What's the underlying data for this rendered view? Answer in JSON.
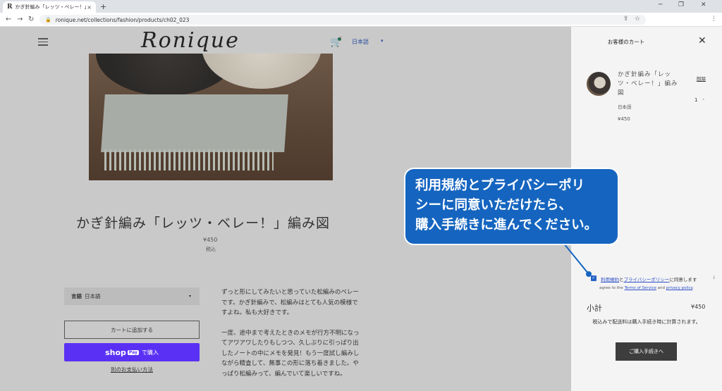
{
  "browser": {
    "tab_favicon": "R",
    "tab_title": "かぎ針編み「レッツ・ベレー！」編み図",
    "tab_close": "×",
    "new_tab": "+",
    "win_min": "─",
    "win_max": "❐",
    "win_close": "✕",
    "back": "←",
    "forward": "→",
    "reload": "↻",
    "lock": "🔒",
    "url": "ronique.net/collections/fashion/products/ch02_023",
    "share": "⇪",
    "star": "☆",
    "menu": "⋮"
  },
  "header": {
    "logo": "Ronique",
    "cart_icon": "🛒",
    "language": "日本語",
    "lang_caret": "▾"
  },
  "product": {
    "title": "かぎ針編み「レッツ・ベレー！」編み図",
    "price": "¥450",
    "tax_note": "税込",
    "option_label": "言語",
    "option_value": "日本語",
    "option_caret": "▾",
    "add_to_cart": "カートに追加する",
    "shop_pay_brand": "shop",
    "shop_pay_badge": "Pay",
    "shop_pay_suffix": "で購入",
    "other_payment": "別のお支払い方法",
    "description": [
      "ずっと形にしてみたいと思っていた松編みのベレーです。かぎ針編みで、松編みはとても人気の模様ですよね。私も大好きです。",
      "一度、途中まで考えたときのメモが行方不明になってアワアワしたりもしつつ、久しぶりに引っぱり出したノートの中にメモを発見！もう一度試し編みしながら精査して、無事この形に落ち着きました。やっぱり松編みって、編んでいて楽しいですね。"
    ]
  },
  "cart": {
    "title": "お客様のカート",
    "close": "✕",
    "item_name": "かぎ針編み「レッツ・ベレー！」編み図",
    "item_variant": "日本語",
    "item_price": "¥450",
    "remove": "削除",
    "qty": "1",
    "qty_caret": "⌃",
    "agree_check": "✓",
    "terms_link": "利用規約",
    "and": "と",
    "privacy_link": "プライバシーポリシー",
    "agree_suffix": "に同意します",
    "info": "i",
    "agree_en_prefix": "agree to the ",
    "terms_en": "Terms of Service",
    "and_en": " and ",
    "privacy_en": "privacy policy",
    "agree_en_end": ".",
    "subtotal_label": "小計",
    "subtotal_value": "¥450",
    "shipping_note": "税込みで配送料は購入手続き時に計算されます。",
    "checkout": "ご購入手続きへ"
  },
  "callout": {
    "lines": [
      "利用規約とプライバシーポリ",
      "シーに同意いただけたら、",
      "購入手続きに進んでください。"
    ]
  },
  "colors": {
    "callout_blue": "#1565c0",
    "shop_pay_purple": "#5a31f4",
    "checkout_dark": "#3d3d3d"
  }
}
